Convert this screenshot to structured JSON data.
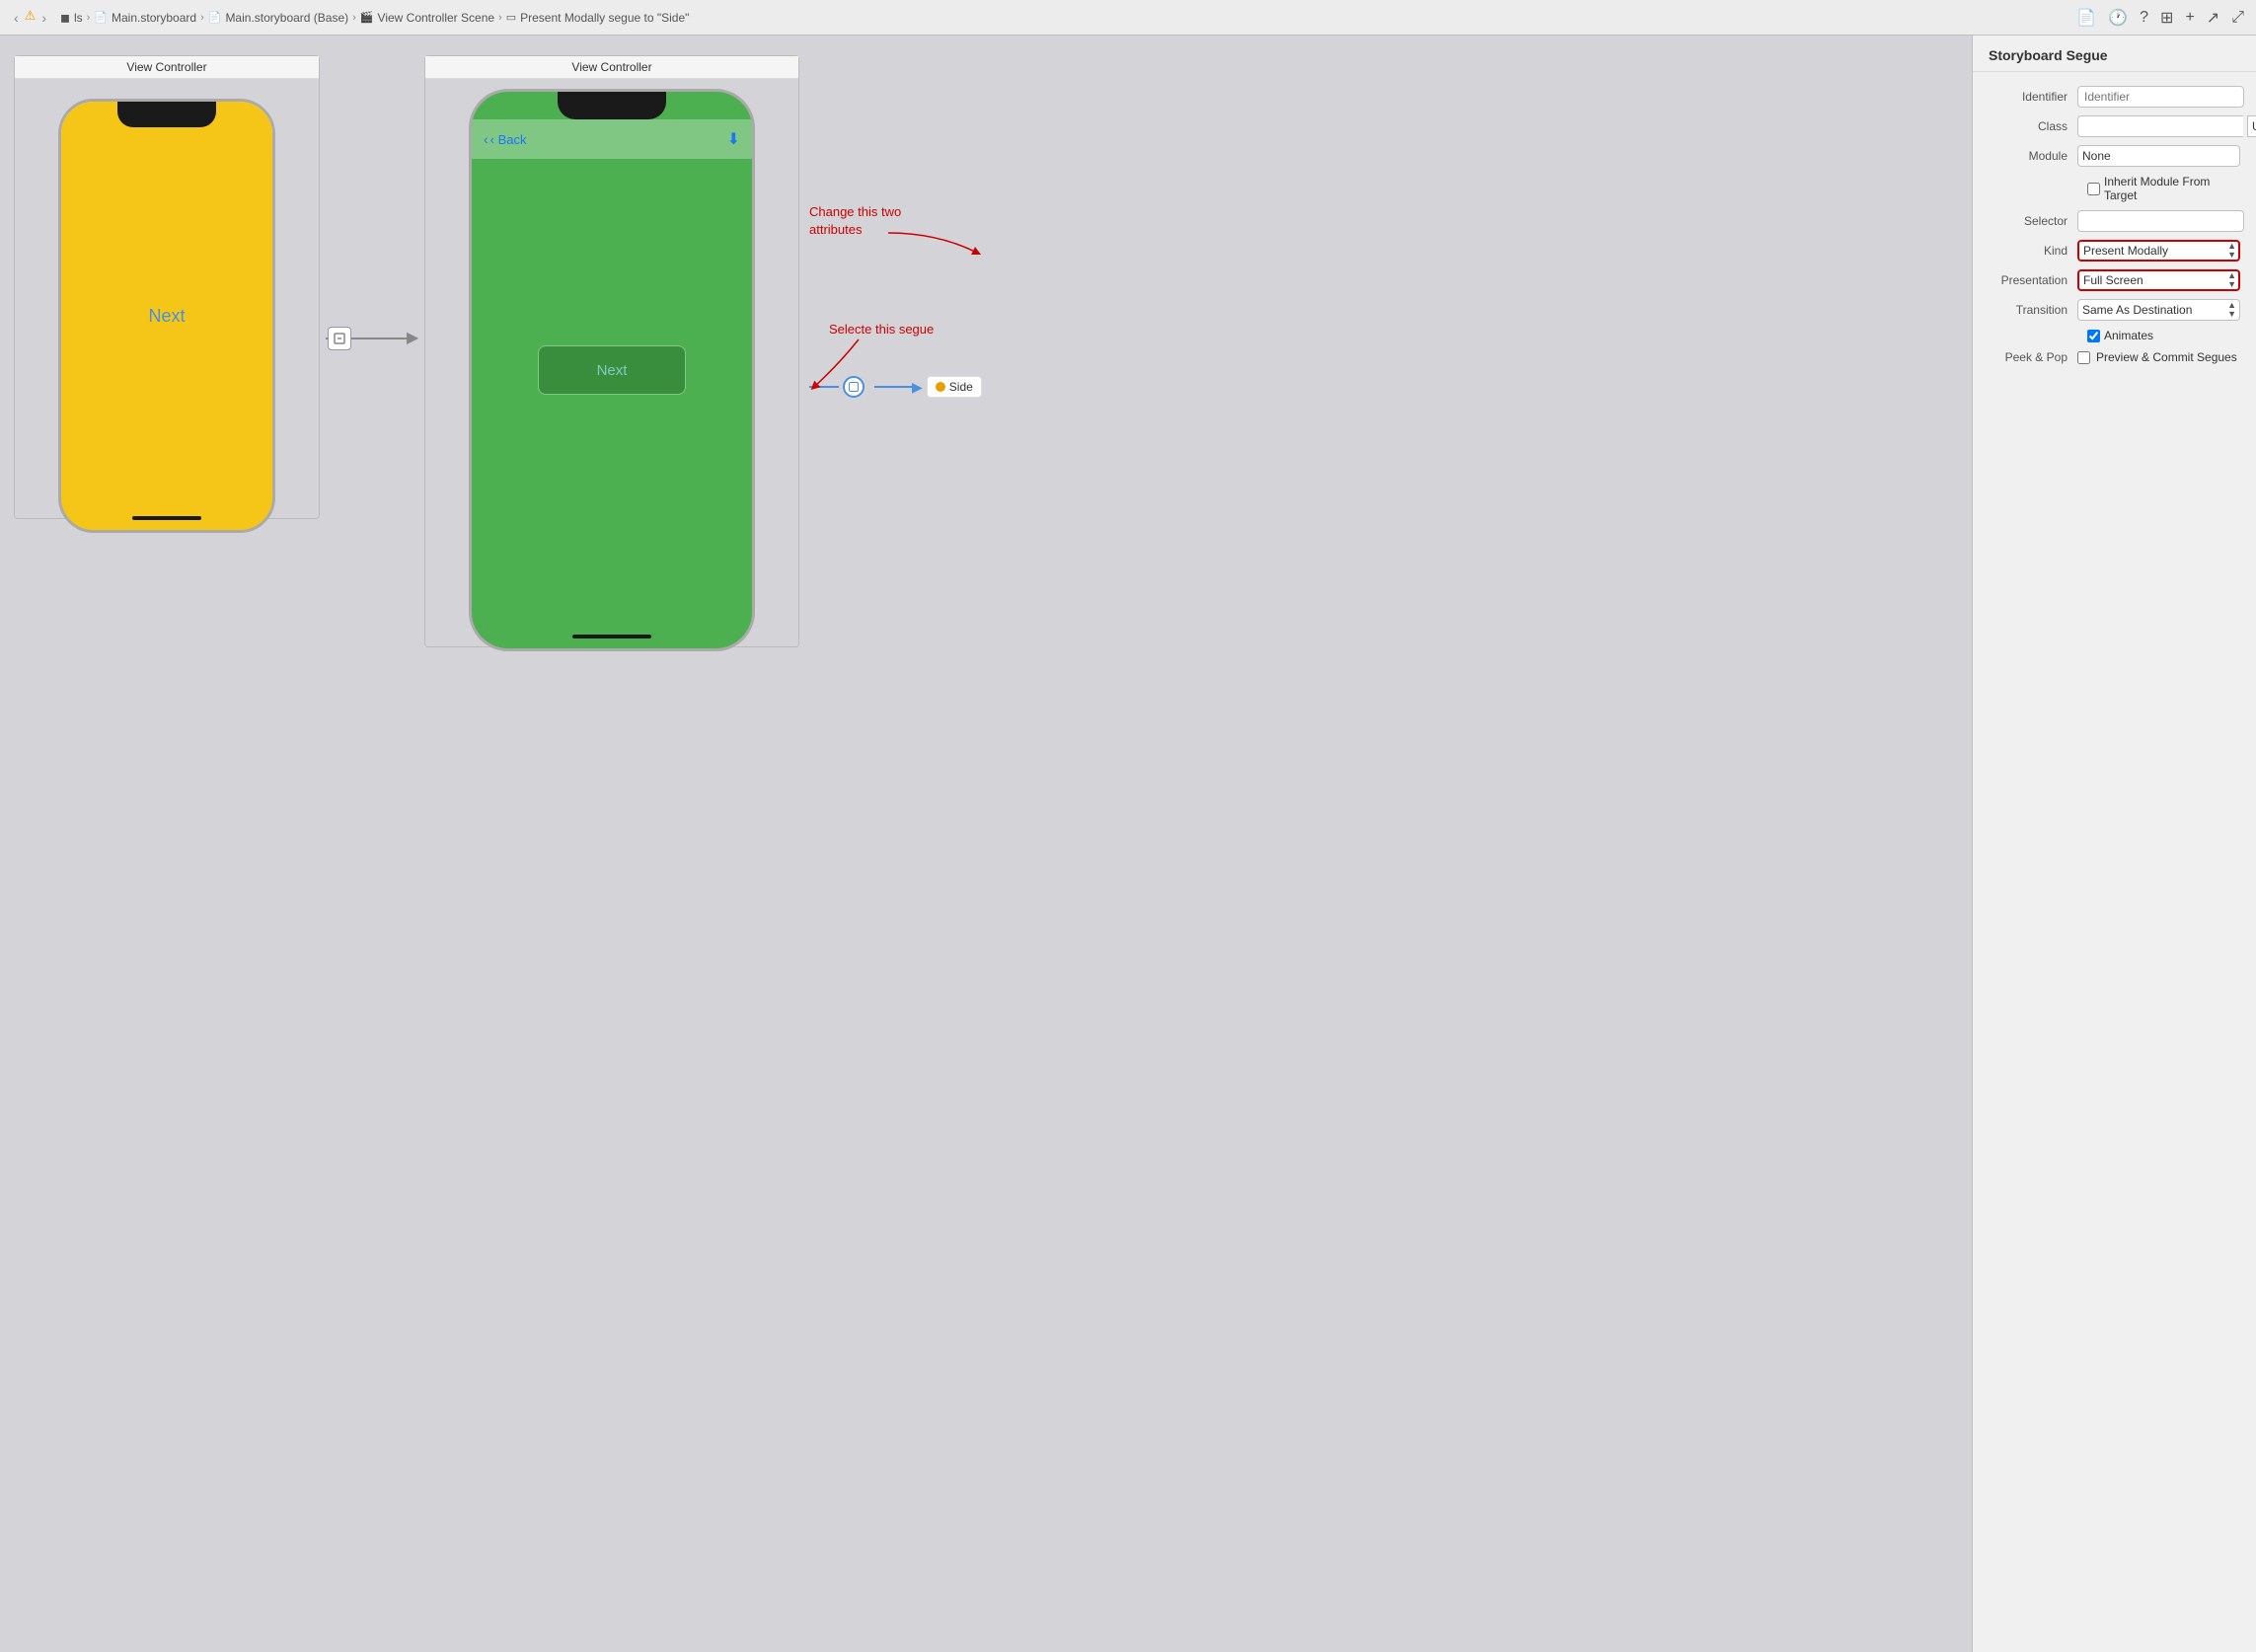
{
  "topbar": {
    "breadcrumbs": [
      {
        "icon": "◼",
        "label": "ls",
        "color": "#888"
      },
      {
        "sep": "›",
        "icon": "📄",
        "label": "Main.storyboard"
      },
      {
        "sep": "›",
        "icon": "📄",
        "label": "Main.storyboard (Base)"
      },
      {
        "sep": "›",
        "icon": "🎬",
        "label": "View Controller Scene"
      },
      {
        "sep": "›",
        "icon": "▭",
        "label": "Present Modally segue to \"Side\""
      }
    ]
  },
  "canvas": {
    "vc_left_title": "View Controller",
    "vc_right_title": "View Controller",
    "next_label_left": "Next",
    "next_label_right": "Next",
    "back_label": "‹ Back",
    "annotation_change": "Change this two\nattributes",
    "annotation_select": "Selecte this segue",
    "side_label": "Side"
  },
  "panel": {
    "title": "Storyboard Segue",
    "fields": {
      "identifier_label": "Identifier",
      "identifier_placeholder": "Identifier",
      "class_label": "Class",
      "class_value": "UIStoryboardSegue",
      "module_label": "Module",
      "module_value": "None",
      "inherit_label": "",
      "inherit_checkbox_label": "Inherit Module From Target",
      "selector_label": "Selector",
      "kind_label": "Kind",
      "kind_value": "Present Modally",
      "presentation_label": "Presentation",
      "presentation_value": "Full Screen",
      "transition_label": "Transition",
      "transition_value": "Same As Destination",
      "animates_label": "Animates",
      "peek_pop_label": "Peek & Pop",
      "preview_label": "Preview & Commit Segues"
    }
  }
}
